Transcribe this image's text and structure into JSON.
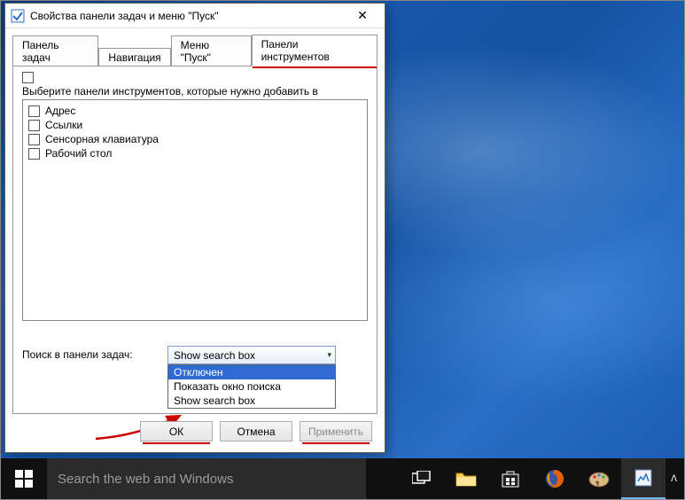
{
  "window": {
    "title": "Свойства панели задач и меню \"Пуск\"",
    "tabs": [
      "Панель задач",
      "Навигация",
      "Меню \"Пуск\"",
      "Панели инструментов"
    ],
    "active_tab_index": 3,
    "instruction": "Выберите панели инструментов, которые нужно добавить в",
    "toolbars": [
      "Адрес",
      "Ссылки",
      "Сенсорная клавиатура",
      "Рабочий стол"
    ],
    "search_label": "Поиск в панели задач:",
    "combo_selected": "Show search box",
    "dropdown_options": [
      "Отключен",
      "Показать окно поиска",
      "Show search box"
    ],
    "dropdown_selected_index": 0,
    "buttons": {
      "ok": "ОК",
      "cancel": "Отмена",
      "apply": "Применить"
    }
  },
  "taskbar": {
    "search_placeholder": "Search the web and Windows"
  }
}
